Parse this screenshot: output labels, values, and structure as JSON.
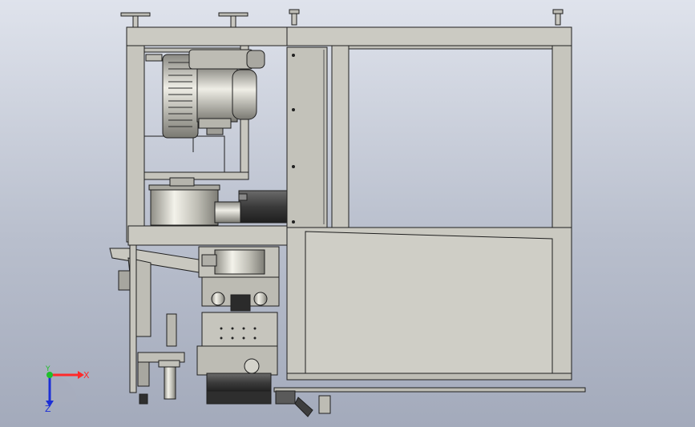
{
  "view": {
    "background_top": "#dfe3ec",
    "background_bottom": "#a3aabb",
    "frame_color": "#c9c8c0",
    "edge_color": "#1f1f1f"
  },
  "triad": {
    "x_label": "X",
    "y_label": "Y",
    "z_label": "Z",
    "x_color": "#ff2a2a",
    "y_color": "#1fbf2b",
    "z_color": "#1c2fd6"
  }
}
